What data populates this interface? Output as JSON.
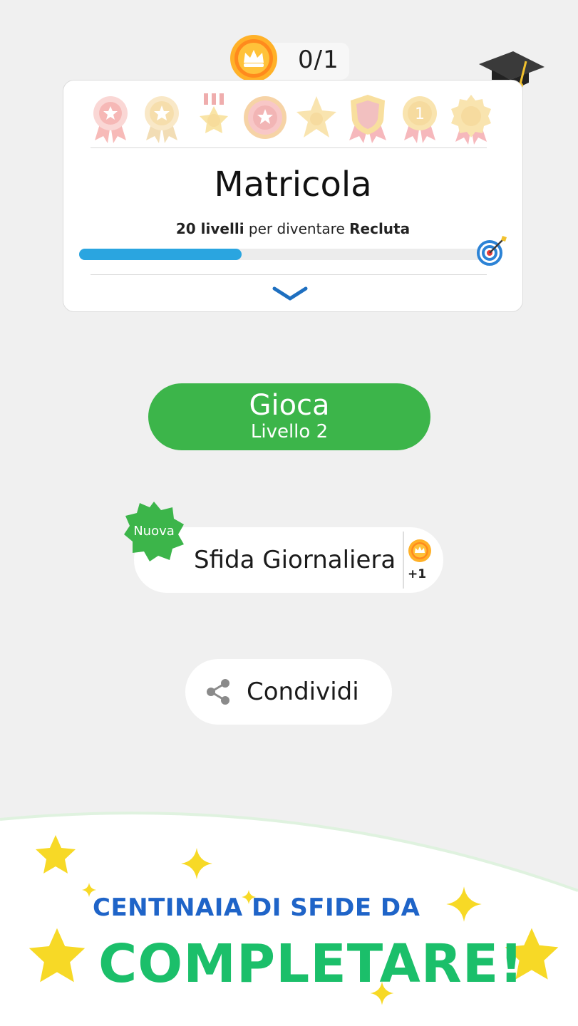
{
  "header": {
    "crowns_count": "0/1"
  },
  "rank": {
    "title": "Matricola",
    "levels_count": "20 livelli",
    "levels_middle": " per diventare ",
    "next_rank": "Recluta",
    "progress": 0.4,
    "badge_icons": [
      "star-ribbon-badge-icon",
      "star-medal-badge-icon",
      "ribbon-medal-icon",
      "star-rosette-badge-icon",
      "sheriff-star-icon",
      "shield-badge-icon",
      "number-one-medal-icon",
      "rosette-badge-icon"
    ]
  },
  "play": {
    "label": "Gioca",
    "level": "Livello 2"
  },
  "daily": {
    "new_label": "Nuova",
    "label": "Sfida Giornaliera",
    "reward": "+1"
  },
  "share": {
    "label": "Condividi"
  },
  "promo": {
    "line1": "CENTINAIA DI SFIDE DA",
    "line2": "COMPLETARE!"
  },
  "colors": {
    "accent_green": "#3cb54a",
    "progress_blue": "#2aa5e0",
    "promo_blue": "#1f64c8",
    "promo_green": "#1bbf6a",
    "star_yellow": "#f7d926"
  }
}
